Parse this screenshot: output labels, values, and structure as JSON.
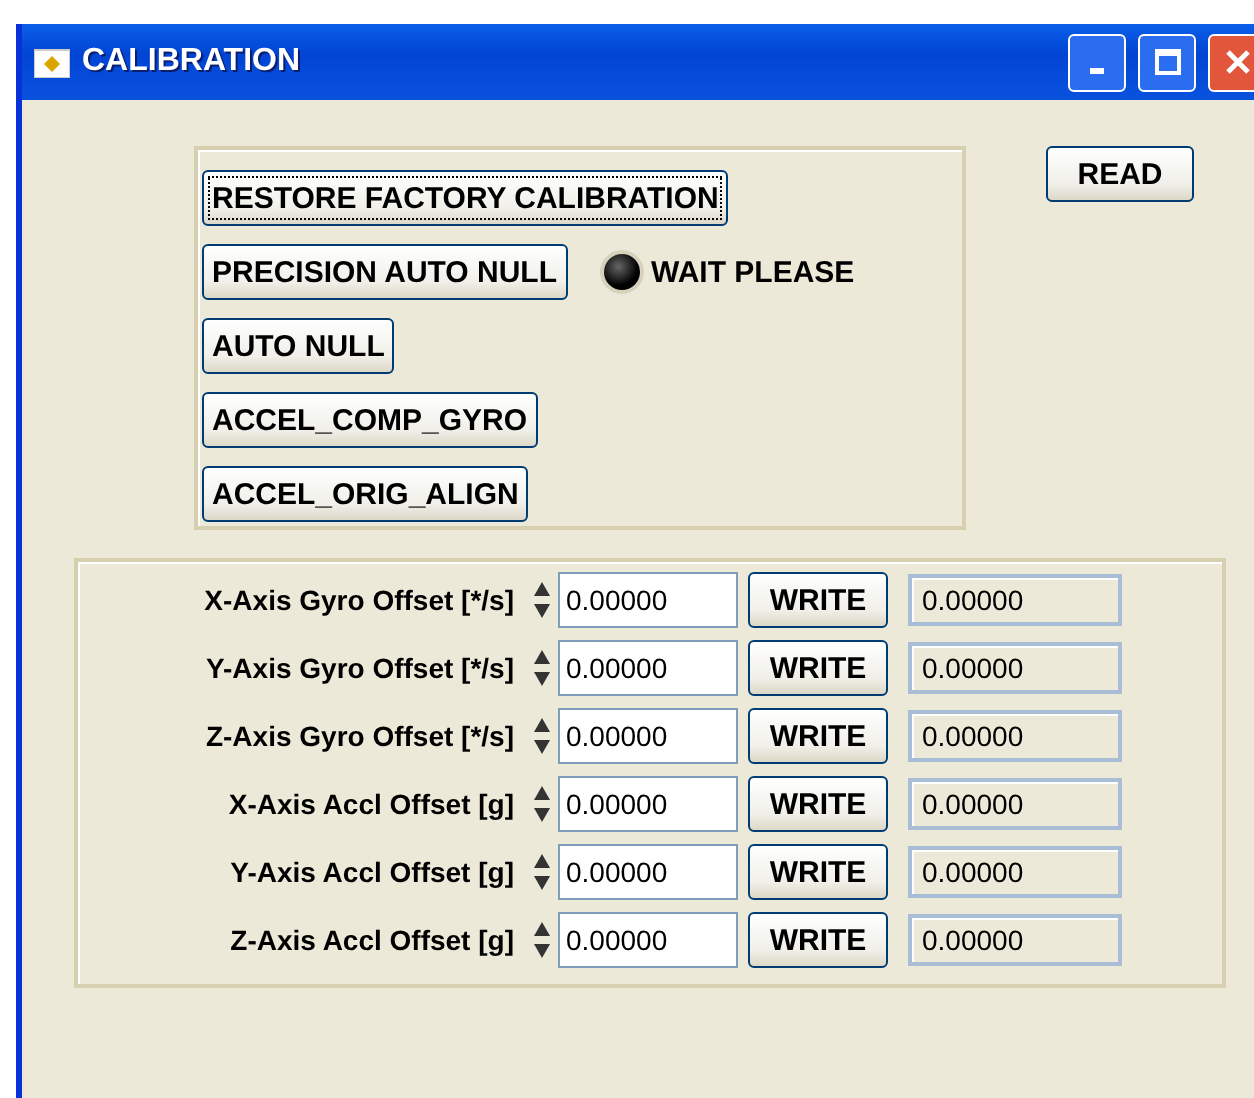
{
  "window": {
    "title": "CALIBRATION"
  },
  "buttons": [
    {
      "label": "RESTORE FACTORY CALIBRATION",
      "focused": true
    },
    {
      "label": "PRECISION AUTO NULL",
      "focused": false
    },
    {
      "label": "AUTO NULL",
      "focused": false
    },
    {
      "label": "ACCEL_COMP_GYRO",
      "focused": false
    },
    {
      "label": "ACCEL_ORIG_ALIGN",
      "focused": false
    }
  ],
  "indicator": {
    "label": "WAIT PLEASE",
    "on": false
  },
  "read_button": "READ",
  "offsets": [
    {
      "label": "X-Axis Gyro Offset [*/s]",
      "value": "0.00000",
      "button": "WRITE",
      "reading": "0.00000"
    },
    {
      "label": "Y-Axis Gyro Offset [*/s]",
      "value": "0.00000",
      "button": "WRITE",
      "reading": "0.00000"
    },
    {
      "label": "Z-Axis Gyro Offset [*/s]",
      "value": "0.00000",
      "button": "WRITE",
      "reading": "0.00000"
    },
    {
      "label": "X-Axis Accl Offset [g]",
      "value": "0.00000",
      "button": "WRITE",
      "reading": "0.00000"
    },
    {
      "label": "Y-Axis Accl Offset [g]",
      "value": "0.00000",
      "button": "WRITE",
      "reading": "0.00000"
    },
    {
      "label": "Z-Axis Accl Offset [g]",
      "value": "0.00000",
      "button": "WRITE",
      "reading": "0.00000"
    }
  ]
}
